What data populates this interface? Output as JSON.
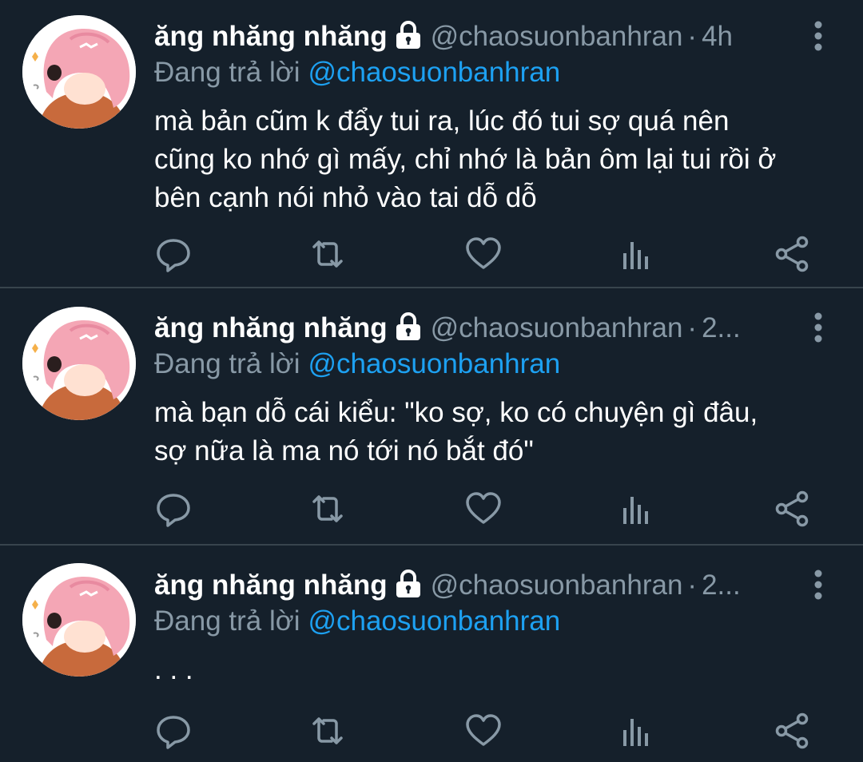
{
  "colors": {
    "background": "#15202b",
    "divider": "#38444d",
    "secondary_text": "#8899a6",
    "link": "#1da1f2",
    "primary_text": "#ffffff"
  },
  "tweets": [
    {
      "display_name": "ăng nhăng nhăng",
      "protected_icon": "lock-icon",
      "handle": "@chaosuonbanhran",
      "separator": "·",
      "time": "4h",
      "reply_prefix": "Đang trả lời",
      "reply_to": "@chaosuonbanhran",
      "text": "mà bản cũm k đẩy tui ra, lúc đó tui sợ quá nên\ncũng ko nhớ gì mấy, chỉ nhớ là bản ôm lại tui rồi ở\nbên cạnh nói nhỏ vào tai dỗ dỗ"
    },
    {
      "display_name": "ăng nhăng nhăng",
      "protected_icon": "lock-icon",
      "handle": "@chaosuonbanhran",
      "separator": "·",
      "time": "2...",
      "reply_prefix": "Đang trả lời",
      "reply_to": "@chaosuonbanhran",
      "text": "mà bạn dỗ cái kiểu: \"ko sợ, ko có chuyện gì đâu,\nsợ nữa là ma nó tới nó bắt đó\""
    },
    {
      "display_name": "ăng nhăng nhăng",
      "protected_icon": "lock-icon",
      "handle": "@chaosuonbanhran",
      "separator": "·",
      "time": "2...",
      "reply_prefix": "Đang trả lời",
      "reply_to": "@chaosuonbanhran",
      "text": ". . ."
    }
  ],
  "action_icons": [
    "reply-icon",
    "retweet-icon",
    "like-icon",
    "analytics-icon",
    "share-icon"
  ]
}
